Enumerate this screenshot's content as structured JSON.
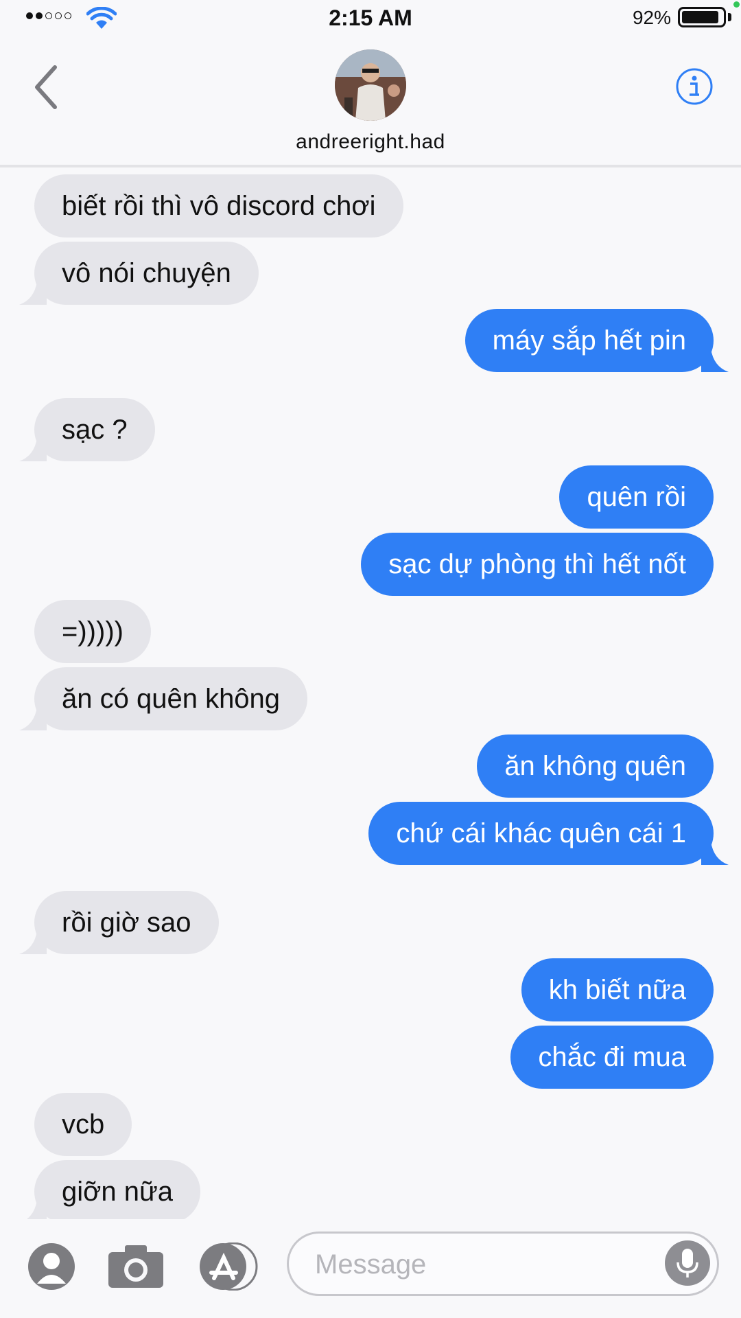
{
  "status_bar": {
    "time": "2:15 AM",
    "battery_percent": "92%",
    "signal_bars_filled": 2,
    "signal_bars_total": 5,
    "battery_level": 0.92,
    "icons": [
      "signal-dots-icon",
      "wifi-icon",
      "battery-icon"
    ]
  },
  "header": {
    "contact_name": "andreeright.had",
    "icons": [
      "back-chevron-icon",
      "avatar",
      "info-icon"
    ]
  },
  "messages": [
    {
      "side": "in",
      "text": "biết rồi thì vô discord chơi",
      "tail": false
    },
    {
      "side": "in",
      "text": "vô nói chuyện",
      "tail": true
    },
    {
      "side": "out",
      "text": "máy sắp hết pin",
      "tail": true
    },
    {
      "side": "in",
      "text": "sạc ?",
      "tail": true
    },
    {
      "side": "out",
      "text": "quên rồi",
      "tail": false
    },
    {
      "side": "out",
      "text": "sạc dự phòng thì hết nốt",
      "tail": false
    },
    {
      "side": "in",
      "text": "=)))))",
      "tail": false
    },
    {
      "side": "in",
      "text": "ăn có quên không",
      "tail": true
    },
    {
      "side": "out",
      "text": "ăn không quên",
      "tail": false
    },
    {
      "side": "out",
      "text": "chứ cái khác quên cái 1",
      "tail": true
    },
    {
      "side": "in",
      "text": "rồi giờ sao",
      "tail": true
    },
    {
      "side": "out",
      "text": "kh biết nữa",
      "tail": false
    },
    {
      "side": "out",
      "text": "chắc đi mua",
      "tail": false
    },
    {
      "side": "in",
      "text": "vcb",
      "tail": false
    },
    {
      "side": "in",
      "text": "giỡn nữa",
      "tail": true
    }
  ],
  "composer": {
    "placeholder": "Message",
    "icons": [
      "contact-icon",
      "camera-icon",
      "app-store-icon",
      "microphone-icon"
    ]
  },
  "colors": {
    "outgoing_bubble": "#2f7ff5",
    "incoming_bubble": "#e5e5ea",
    "accent": "#2f7ff5"
  }
}
